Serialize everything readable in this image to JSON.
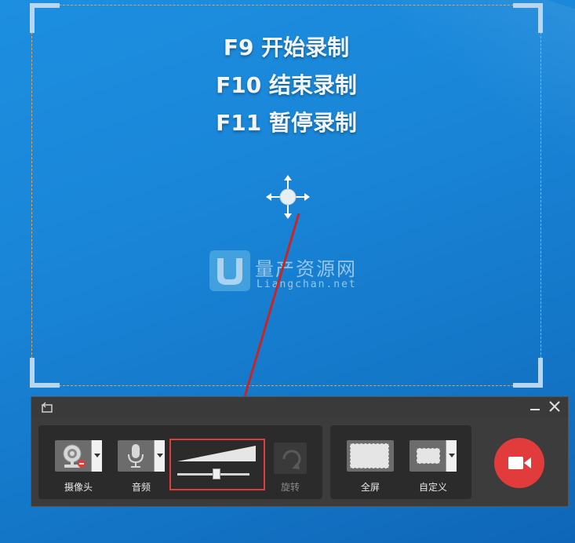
{
  "capture": {
    "hints": [
      "F9 开始录制",
      "F10 结束录制",
      "F11 暂停录制"
    ]
  },
  "watermark": {
    "title": "量产资源网",
    "subtitle": "Liangchan.net"
  },
  "toolbar": {
    "camera_label": "摄像头",
    "audio_label": "音频",
    "rotate_label": "旋转",
    "fullscreen_label": "全屏",
    "custom_label": "自定义",
    "volume_level": 0.55
  },
  "colors": {
    "desktop": "#1a86d8",
    "record": "#e13b3b",
    "highlight": "#e23c3c",
    "frame_dash": "#d9a75a"
  }
}
